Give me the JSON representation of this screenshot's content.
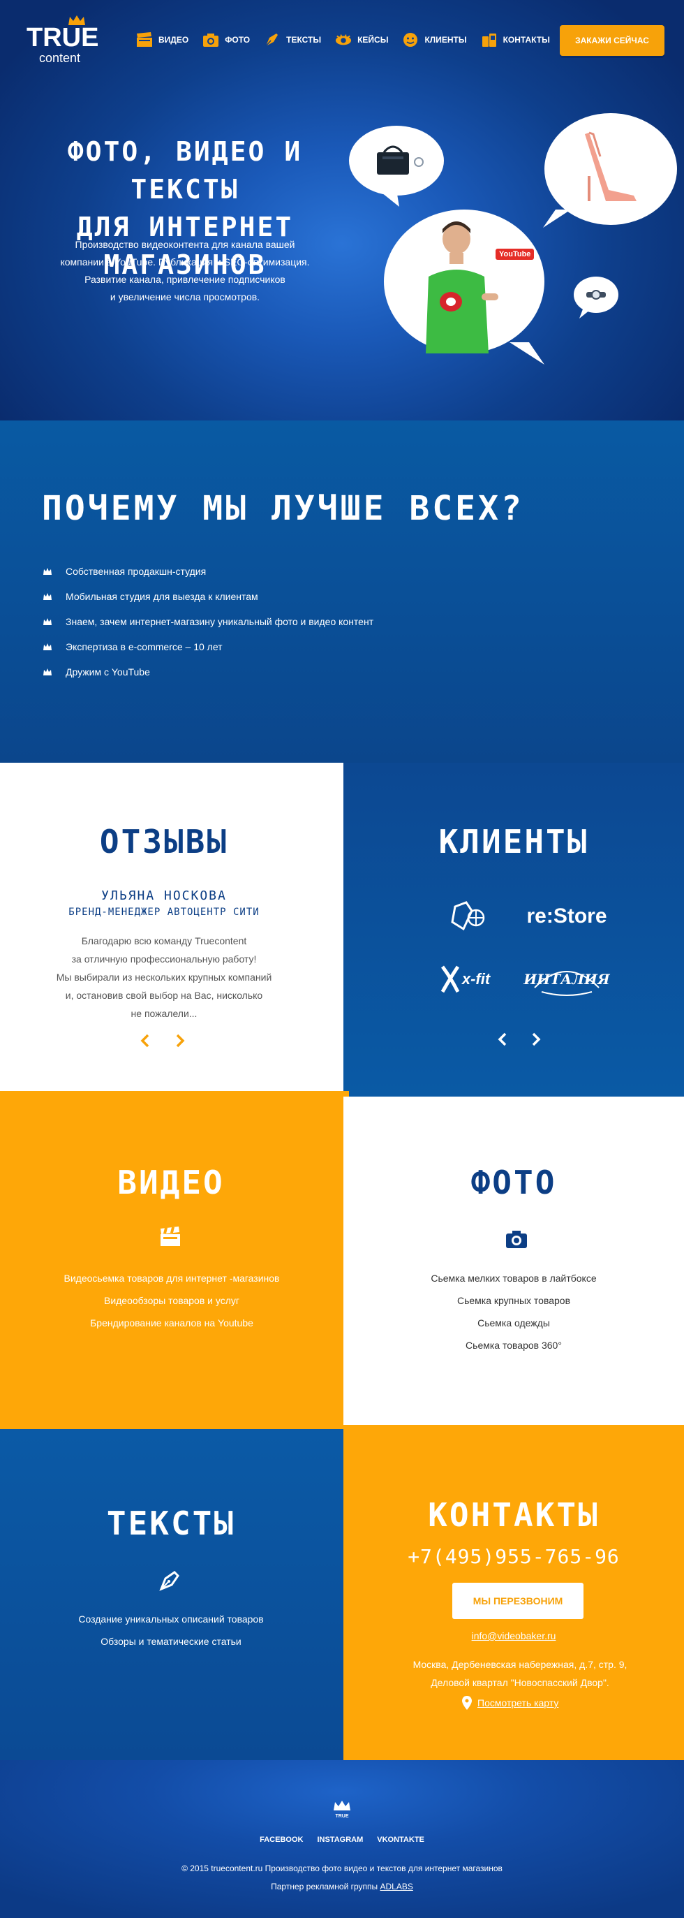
{
  "logo": {
    "word": "TRUE",
    "sub": "content"
  },
  "nav": {
    "items": [
      {
        "label": "ВИДЕО",
        "icon": "clapperboard-icon"
      },
      {
        "label": "ФОТО",
        "icon": "camera-icon"
      },
      {
        "label": "ТЕКСТЫ",
        "icon": "pen-icon"
      },
      {
        "label": "КЕЙСЫ",
        "icon": "eye-icon"
      },
      {
        "label": "КЛИЕНТЫ",
        "icon": "smiley-icon"
      },
      {
        "label": "КОНТАКТЫ",
        "icon": "phone-icon"
      }
    ],
    "cta": "ЗАКАЖИ СЕЙЧАС"
  },
  "hero": {
    "title_line1": "ФОТО, ВИДЕО И ТЕКСТЫ",
    "title_line2": "ДЛЯ ИНТЕРНЕТ МАГАЗИНОВ",
    "text_line1": "Производство видеоконтента для канала вашей",
    "text_line2": "компании в YouTube. Публикация и SEO-оптимизация.",
    "text_line3": "Развитие канала, привлечение подписчиков",
    "text_line4": "и увеличение числа просмотров.",
    "youtube_badge": "YouTube"
  },
  "why": {
    "title": "ПОЧЕМУ МЫ ЛУЧШЕ ВСЕХ?",
    "items": [
      "Собственная продакшн-студия",
      "Мобильная студия для выезда к клиентам",
      "Знаем, зачем интернет-магазину уникальный фото и видео контент",
      "Экспертиза в e-commerce – 10 лет",
      "Дружим с YouTube"
    ]
  },
  "reviews": {
    "title": "ОТЗЫВЫ",
    "name": "УЛЬЯНА НОСКОВА",
    "role": "БРЕНД-МЕНЕДЖЕР АВТОЦЕНТР СИТИ",
    "text_line1": "Благодарю всю команду Truecontent",
    "text_line2": "за отличную профессиональную работу!",
    "text_line3": "Мы выбирали из нескольких крупных компаний",
    "text_line4": "и, остановив свой выбор на Вас, нисколько",
    "text_line5": "не пожалели..."
  },
  "clients": {
    "title": "КЛИЕНТЫ",
    "logos": [
      "re:Store",
      "x-fit",
      "ИНТАЛИЯ"
    ]
  },
  "video": {
    "title": "ВИДЕО",
    "items": [
      "Видеосьемка товаров для интернет -магазинов",
      "Видеообзоры товаров и услуг",
      "Брендирование каналов на Youtube"
    ]
  },
  "photo": {
    "title": "ФОТО",
    "items": [
      "Сьемка мелких товаров в лайтбоксе",
      "Сьемка крупных товаров",
      "Сьемка одежды",
      "Сьемка товаров 360°"
    ]
  },
  "texts": {
    "title": "ТЕКСТЫ",
    "items": [
      "Создание уникальных описаний товаров",
      "Обзоры и тематические статьи"
    ]
  },
  "contacts": {
    "title": "КОНТАКТЫ",
    "phone": "+7(495)955-765-96",
    "callback": "МЫ ПЕРЕЗВОНИМ",
    "email": "info@videobaker.ru",
    "address_line1": "Москва, Дербеневская набережная, д.7, стр. 9,",
    "address_line2": "Деловой квартал \"Новоспасский Двор\".",
    "map_link": "Посмотреть карту"
  },
  "footer": {
    "logo_word": "TRUE",
    "social": [
      "FACEBOOK",
      "INSTAGRAM",
      "VKONTAKTE"
    ],
    "copyright": "© 2015 truecontent.ru  Производство фото видео и текстов для интернет магазинов",
    "partner_prefix": "Партнер  рекламной группы",
    "partner_link": "ADLABS"
  },
  "colors": {
    "orange": "#fea708",
    "blue": "#0b4a92",
    "navy_text": "#0c3e85"
  }
}
